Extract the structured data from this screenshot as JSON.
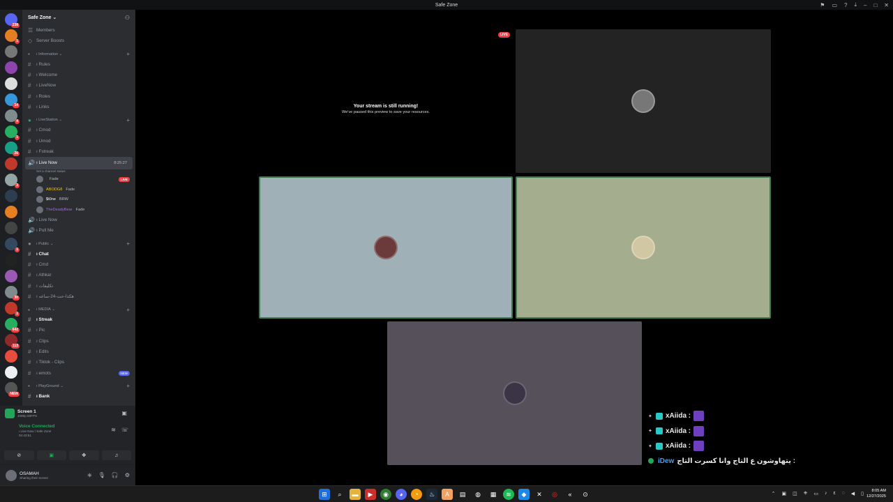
{
  "window": {
    "title": "Safe Zone"
  },
  "server_list": [
    {
      "badge": "238"
    },
    {
      "badge": "1"
    },
    {
      "badge": ""
    },
    {
      "badge": ""
    },
    {
      "badge": ""
    },
    {
      "badge": "14"
    },
    {
      "badge": "4"
    },
    {
      "badge": "1"
    },
    {
      "badge": "26"
    },
    {
      "badge": ""
    },
    {
      "badge": "3"
    },
    {
      "badge": ""
    },
    {
      "badge": ""
    },
    {
      "badge": ""
    },
    {
      "badge": "1"
    },
    {
      "badge": ""
    },
    {
      "badge": ""
    },
    {
      "badge": "30"
    },
    {
      "badge": "1"
    },
    {
      "badge": "642"
    },
    {
      "badge": "113"
    },
    {
      "badge": ""
    },
    {
      "badge": ""
    },
    {
      "badge": "NEW"
    }
  ],
  "guild": {
    "name": "Safe Zone"
  },
  "top_items": [
    {
      "label": "Members"
    },
    {
      "label": "Server Boosts"
    }
  ],
  "categories": {
    "information": {
      "label": "ı Information",
      "channels": [
        "ı Rules",
        "ı Welcome",
        "ı LiveNow",
        "ı Roles",
        "ı Links"
      ]
    },
    "livestation": {
      "label": "ı LiveStation",
      "channels": [
        "ı Cmod",
        "ı Umod",
        "ı Fstreak"
      ]
    },
    "public": {
      "label": "ı Public",
      "channels": [
        "ı Chat",
        "ı Cmd",
        "ı Athkar",
        "ı تكليفات",
        "ı هكذا-حت-24-ساعه"
      ]
    },
    "media": {
      "label": "ı MEDIA",
      "channels": [
        "ı Streak",
        "ı Pic",
        "ı Clips",
        "ı Edits",
        "ı Tiktok - Clips",
        "ı emots"
      ]
    },
    "playground": {
      "label": "ı PlayGround",
      "channels": [
        "ı Bank"
      ]
    }
  },
  "voice": {
    "live_now": {
      "label": "ı Live Now",
      "timer": "8:25:27",
      "status": "Set a channel status"
    },
    "users": [
      {
        "name": "",
        "tag": "Fade",
        "live": "LIVE"
      },
      {
        "name": "ABODG8",
        "tag": "Fade",
        "live": ""
      },
      {
        "name": "$t0ne",
        "tag": "BRW",
        "live": ""
      },
      {
        "name": "TheDeadyBear",
        "tag": "Fade",
        "live": ""
      }
    ],
    "other": [
      "ı Live Now",
      "ı Pull Me"
    ],
    "new_badge": "NEW"
  },
  "panel": {
    "screen_title": "Screen 1",
    "screen_sub": "1080p 60FPS",
    "voice_connected": "Voice Connected",
    "voice_channel": "ı Live Now / Safe Zone",
    "voice_time": "04:43:51"
  },
  "user": {
    "name": "OSAMAH",
    "status": "Sharing their screen"
  },
  "stage": {
    "live_tag": "LIVE",
    "paused_title": "Your stream is still running!",
    "paused_sub": "We've paused this preview to save your resources.",
    "colors": {
      "tile_blue": "#9fb0b7",
      "tile_green": "#a4ae8e",
      "tile_gray": "#55505a",
      "tile_dark": "#232323"
    }
  },
  "chat_overlay": [
    {
      "user": "xAiida :",
      "text": ""
    },
    {
      "user": "xAiida :",
      "text": ""
    },
    {
      "user": "xAiida :",
      "text": ""
    },
    {
      "user": "iDew",
      "text": "يتهاوشون ع التاج وانا كسرت التاج :"
    }
  ],
  "clock": {
    "time": "8:05 AM",
    "date": "12/27/2025"
  }
}
